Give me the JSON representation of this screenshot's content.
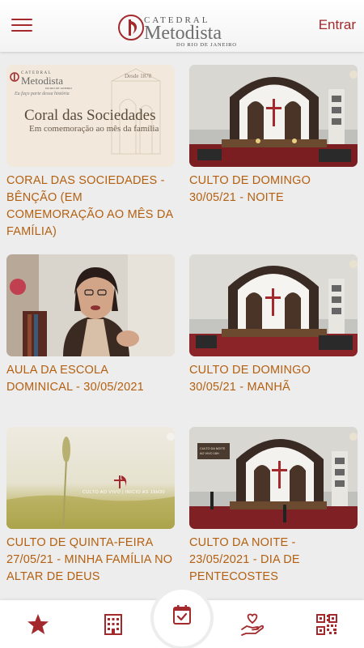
{
  "header": {
    "logo_small": "CATEDRAL",
    "logo_big": "Metodista",
    "logo_sub": "DO RIO DE JANEIRO",
    "login_label": "Entrar"
  },
  "thumb_texts": {
    "coral_small": "CATEDRAL",
    "coral_brand": "Metodista",
    "coral_rj": "DO RIO DE JANEIRO",
    "coral_tagline": "Eu faço parte dessa história",
    "coral_since": "Desde 1878",
    "coral_title": "Coral das Sociedades",
    "coral_subtitle": "Em comemoração ao mês da família",
    "quinta_overlay": "CULTO AO VIVO | INÍCIO AS 19H30",
    "noite_banner_1": "CULTO DA NOITE",
    "noite_banner_2": "AO VIVO 18H"
  },
  "videos": [
    {
      "title": "CORAL DAS SOCIEDADES - BÊNÇÃO (EM COMEMORAÇÃO AO MÊS DA FAMÍLIA)"
    },
    {
      "title": "CULTO DE DOMINGO 30/05/21 - NOITE"
    },
    {
      "title": "AULA DA ESCOLA DOMINICAL - 30/05/2021"
    },
    {
      "title": "CULTO DE DOMINGO 30/05/21 - MANHÃ"
    },
    {
      "title": "CULTO DE QUINTA-FEIRA 27/05/21 - MINHA FAMÍLIA NO ALTAR DE DEUS"
    },
    {
      "title": "CULTO DA NOITE - 23/05/2021 - DIA DE PENTECOSTES"
    }
  ],
  "colors": {
    "accent": "#a3292d",
    "title": "#b46010",
    "background": "#eeeded"
  },
  "bottom_nav": [
    "star-icon",
    "building-icon",
    "calendar-check-icon",
    "heart-hand-icon",
    "qr-code-icon"
  ]
}
